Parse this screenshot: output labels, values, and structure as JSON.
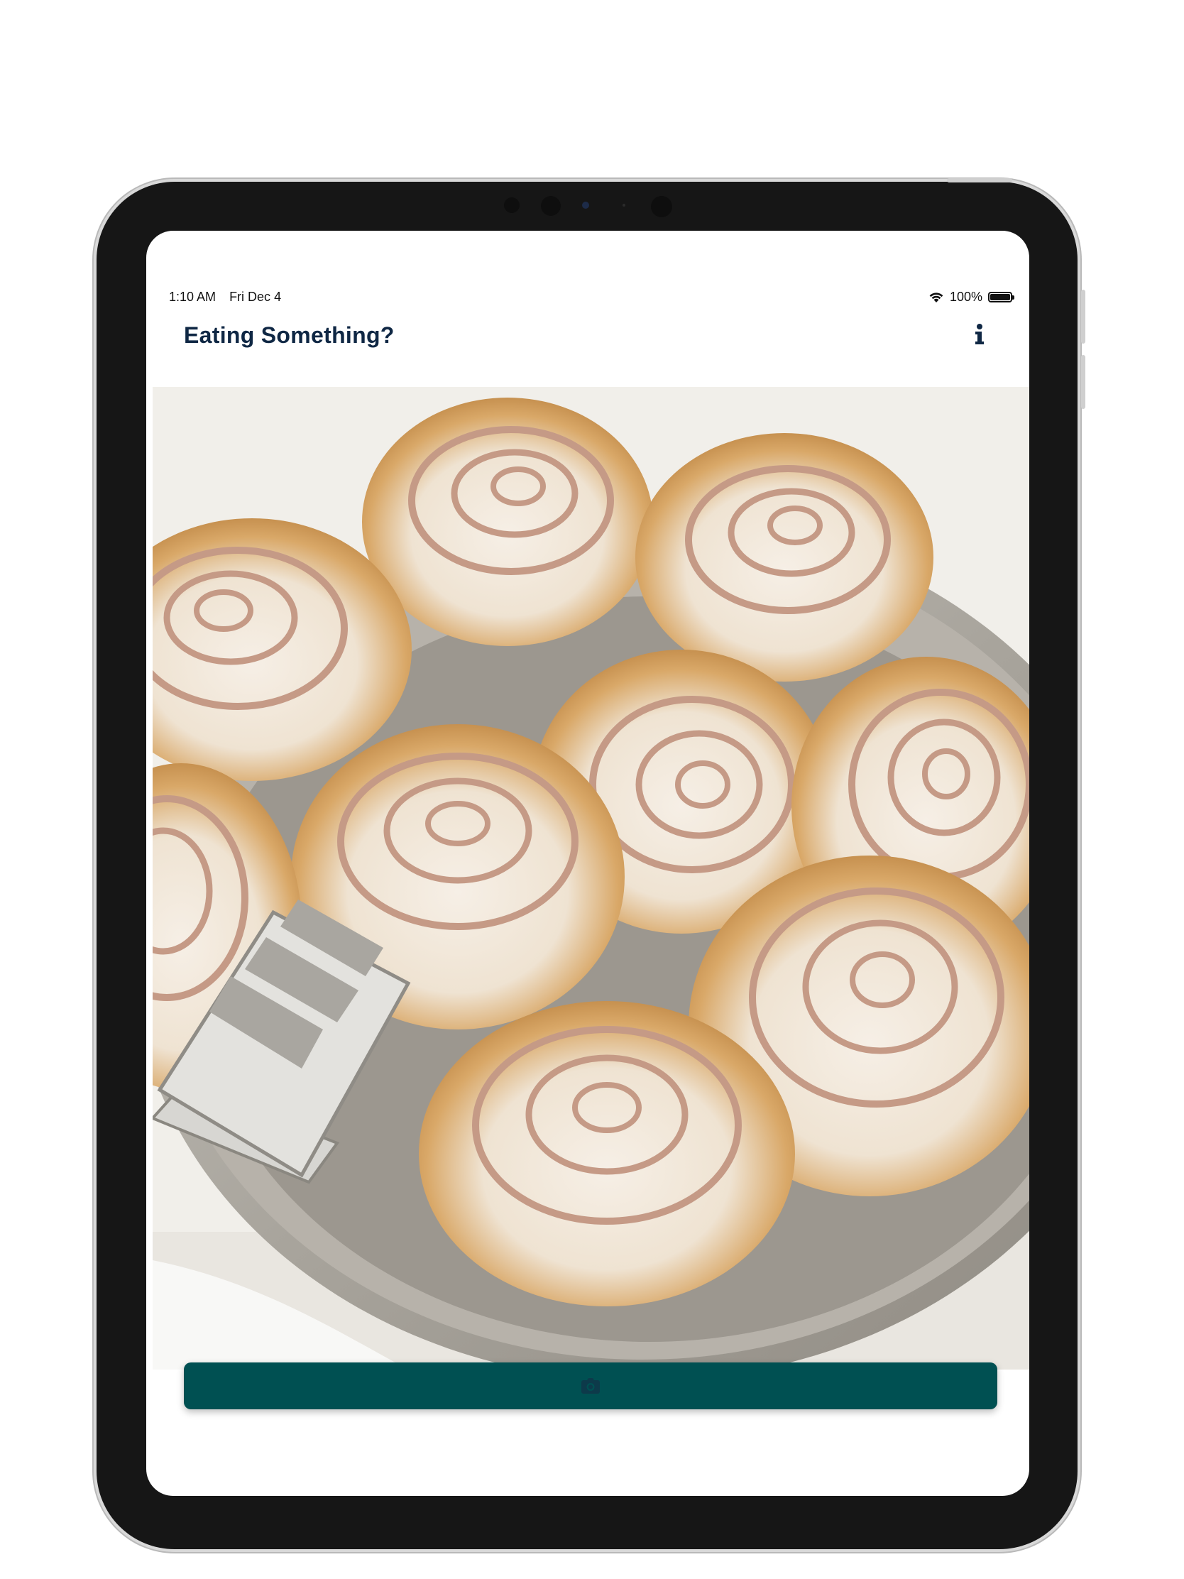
{
  "status_bar": {
    "time": "1:10 AM",
    "date": "Fri Dec 4",
    "battery_text": "100%",
    "battery_level": 1.0,
    "wifi_icon": "wifi-icon",
    "battery_icon": "battery-icon"
  },
  "nav": {
    "title": "Eating Something?",
    "info_icon": "info-icon"
  },
  "photo": {
    "subject": "cinnamon-rolls-photo"
  },
  "camera_button": {
    "icon": "camera-icon"
  },
  "colors": {
    "title": "#0f2744",
    "button": "#005052",
    "button_icon": "#0d3a4a",
    "device": "#161616"
  }
}
